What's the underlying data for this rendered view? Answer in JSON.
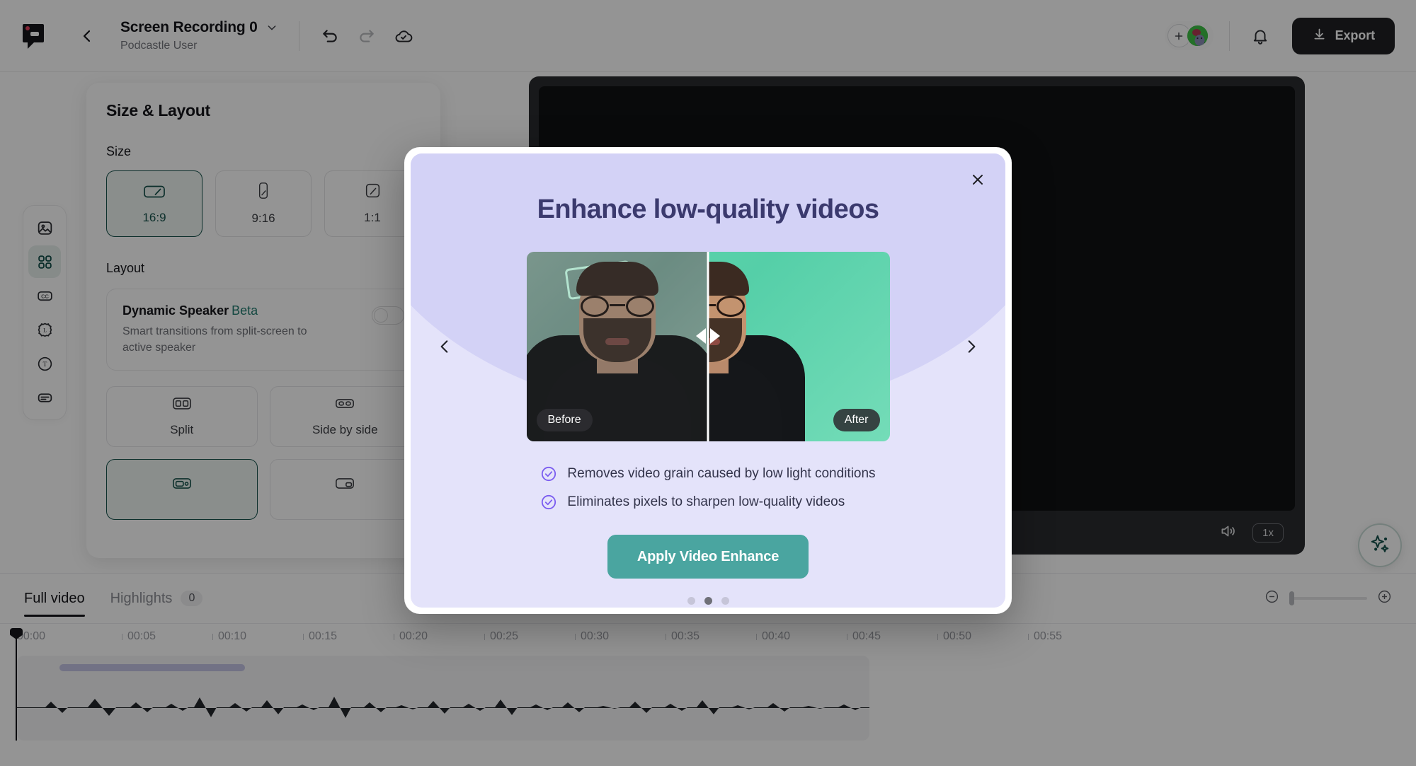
{
  "header": {
    "logo_icon": "podcastle-logo-icon",
    "back_icon": "chevron-left-icon",
    "project_title": "Screen Recording 0",
    "title_caret_icon": "chevron-down-icon",
    "project_subtitle": "Podcastle User",
    "undo_icon": "undo-icon",
    "redo_icon": "redo-icon",
    "cloud_saved_icon": "cloud-check-icon",
    "add_collaborator_icon": "plus-icon",
    "avatar_icon": "user-avatar",
    "notifications_icon": "bell-icon",
    "export_label": "Export",
    "export_icon": "download-icon"
  },
  "rail": {
    "items": [
      {
        "name": "media",
        "icon": "image-icon",
        "active": false
      },
      {
        "name": "size-layout",
        "icon": "grid-icon",
        "active": true
      },
      {
        "name": "captions",
        "icon": "cc-icon",
        "active": false
      },
      {
        "name": "brand",
        "icon": "brand-l-icon",
        "active": false
      },
      {
        "name": "text",
        "icon": "text-t-icon",
        "active": false
      },
      {
        "name": "transcript",
        "icon": "transcript-icon",
        "active": false
      }
    ]
  },
  "panel": {
    "title": "Size & Layout",
    "size_label": "Size",
    "sizes": [
      {
        "label": "16:9",
        "icon": "aspect-16-9-icon",
        "selected": true
      },
      {
        "label": "9:16",
        "icon": "aspect-9-16-icon",
        "selected": false
      },
      {
        "label": "1:1",
        "icon": "aspect-1-1-icon",
        "selected": false
      }
    ],
    "layout_label": "Layout",
    "dynamic_speaker": {
      "title": "Dynamic Speaker",
      "badge": "Beta",
      "description": "Smart transitions from split-screen to active speaker",
      "toggle_on": false
    },
    "layouts": [
      {
        "label": "Split",
        "icon": "layout-split-icon",
        "selected": false
      },
      {
        "label": "Side by side",
        "icon": "layout-side-by-side-icon",
        "selected": false
      },
      {
        "label": "",
        "icon": "layout-pip-icon",
        "selected": true
      },
      {
        "label": "",
        "icon": "layout-pip-alt-icon",
        "selected": false
      }
    ]
  },
  "preview": {
    "volume_icon": "volume-icon",
    "speed_label": "1x",
    "ai_icon": "sparkle-ai-icon"
  },
  "timeline": {
    "tabs": [
      {
        "label": "Full video",
        "active": true
      },
      {
        "label": "Highlights",
        "active": false,
        "badge": "0"
      }
    ],
    "zoom_out_icon": "minus-circle-icon",
    "zoom_in_icon": "plus-circle-icon",
    "ticks": [
      "00:00",
      "00:05",
      "00:10",
      "00:15",
      "00:20",
      "00:25",
      "00:30",
      "00:35",
      "00:40",
      "00:45",
      "00:50",
      "00:55"
    ],
    "playhead_position": "00:00"
  },
  "modal": {
    "close_icon": "close-icon",
    "title": "Enhance low-quality videos",
    "prev_icon": "chevron-left-icon",
    "next_icon": "chevron-right-icon",
    "before_label": "Before",
    "after_label": "After",
    "bullets": [
      "Removes video grain caused by low light conditions",
      "Eliminates pixels to sharpen low-quality videos"
    ],
    "check_icon": "check-circle-icon",
    "cta_label": "Apply Video Enhance",
    "dots_total": 3,
    "dots_active_index": 1
  },
  "colors": {
    "accent_teal": "#4aa5a0",
    "modal_bg": "#e4e3fa",
    "modal_title": "#3b3a6e",
    "check_purple": "#7a5cf0",
    "export_dark": "#1f2024",
    "selected_green": "#16524b"
  }
}
